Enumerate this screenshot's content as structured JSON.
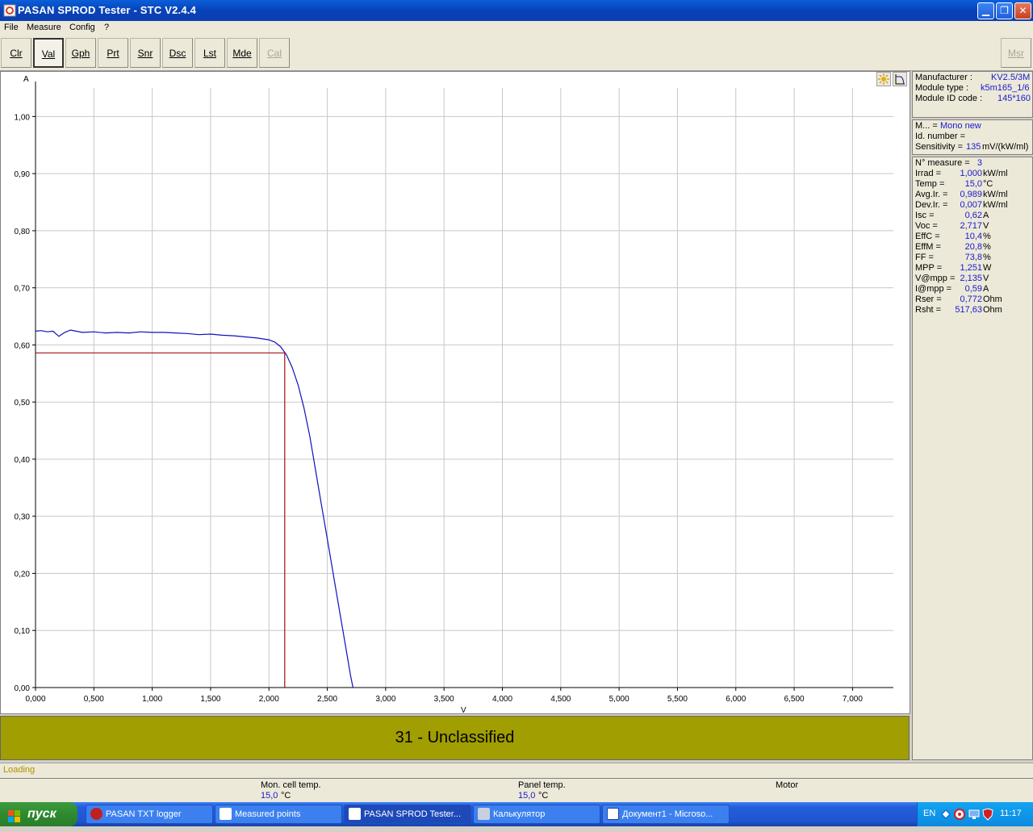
{
  "window": {
    "title": "PASAN SPROD Tester - STC V2.4.4"
  },
  "menu": [
    "File",
    "Measure",
    "Config",
    "?"
  ],
  "toolbar": {
    "buttons": [
      "Clr",
      "Val",
      "Gph",
      "Prt",
      "Snr",
      "Dsc",
      "Lst",
      "Mde",
      "Cal"
    ],
    "right_button": "Msr"
  },
  "module_info": {
    "manufacturer_label": "Manufacturer :",
    "manufacturer": "KV2.5/3M",
    "module_type_label": "Module type :",
    "module_type": "k5m165_1/6",
    "module_id_label": "Module ID code :",
    "module_id": "145*160"
  },
  "cell_info": {
    "m_label": "M... =",
    "m_value": "Mono new",
    "id_label": "Id. number =",
    "sensitivity_label": "Sensitivity =",
    "sensitivity": "135",
    "sensitivity_unit": "mV/(kW/ml)"
  },
  "results": [
    {
      "label": "N° measure =",
      "value": "3",
      "unit": ""
    },
    {
      "label": "Irrad =",
      "value": "1,000",
      "unit": "kW/ml"
    },
    {
      "label": "Temp =",
      "value": "15,0",
      "unit": "°C"
    },
    {
      "label": "Avg.Ir. =",
      "value": "0,989",
      "unit": "kW/ml"
    },
    {
      "label": "Dev.Ir. =",
      "value": "0,007",
      "unit": "kW/ml"
    },
    {
      "label": "Isc =",
      "value": "0,62",
      "unit": "A"
    },
    {
      "label": "Voc =",
      "value": "2,717",
      "unit": "V"
    },
    {
      "label": "EffC =",
      "value": "10,4",
      "unit": "%"
    },
    {
      "label": "EffM =",
      "value": "20,8",
      "unit": "%"
    },
    {
      "label": "FF =",
      "value": "73,8",
      "unit": "%"
    },
    {
      "label": "MPP =",
      "value": "1,251",
      "unit": "W"
    },
    {
      "label": "V@mpp =",
      "value": "2,135",
      "unit": "V"
    },
    {
      "label": "I@mpp =",
      "value": "0,59",
      "unit": "A"
    },
    {
      "label": "Rser =",
      "value": "0,772",
      "unit": "Ohm"
    },
    {
      "label": "Rsht =",
      "value": "517,63",
      "unit": "Ohm"
    }
  ],
  "classification": "31 - Unclassified",
  "status": {
    "loading": "Loading",
    "mon_cell_label": "Mon. cell temp.",
    "mon_cell_value": "15,0",
    "mon_cell_unit": "°C",
    "panel_label": "Panel temp.",
    "panel_value": "15,0",
    "panel_unit": "°C",
    "motor_label": "Motor"
  },
  "taskbar": {
    "start": "пуск",
    "tasks": [
      {
        "label": "PASAN TXT logger",
        "active": false
      },
      {
        "label": "Measured points",
        "active": false
      },
      {
        "label": "PASAN SPROD Tester...",
        "active": true
      },
      {
        "label": "Калькулятор",
        "active": false
      },
      {
        "label": "Документ1 - Microso...",
        "active": false
      }
    ],
    "lang": "EN",
    "clock": "11:17"
  },
  "chart_data": {
    "type": "line",
    "xlabel": "V",
    "ylabel": "A",
    "xlim": [
      0,
      7.35
    ],
    "ylim": [
      0,
      1.05
    ],
    "x_ticks": [
      "0,000",
      "0,500",
      "1,000",
      "1,500",
      "2,000",
      "2,500",
      "3,000",
      "3,500",
      "4,000",
      "4,500",
      "5,000",
      "5,500",
      "6,000",
      "6,500",
      "7,000"
    ],
    "y_ticks": [
      "0,00",
      "0,10",
      "0,20",
      "0,30",
      "0,40",
      "0,50",
      "0,60",
      "0,70",
      "0,80",
      "0,90",
      "1,00"
    ],
    "grid": true,
    "colors": {
      "curve": "#1010c0",
      "mpp": "#a01010",
      "grid": "#c8c8c8"
    },
    "series": [
      {
        "x": [
          0.0,
          0.05,
          0.1,
          0.15,
          0.2,
          0.25,
          0.3,
          0.4,
          0.5,
          0.6,
          0.7,
          0.8,
          0.9,
          1.0,
          1.1,
          1.2,
          1.3,
          1.4,
          1.5,
          1.6,
          1.7,
          1.8,
          1.9,
          2.0,
          2.05,
          2.1,
          2.15,
          2.2,
          2.25,
          2.3,
          2.35,
          2.4,
          2.45,
          2.5,
          2.55,
          2.6,
          2.65,
          2.7,
          2.72
        ],
        "y": [
          0.624,
          0.625,
          0.623,
          0.624,
          0.615,
          0.622,
          0.626,
          0.622,
          0.623,
          0.621,
          0.622,
          0.621,
          0.623,
          0.622,
          0.622,
          0.621,
          0.62,
          0.618,
          0.619,
          0.617,
          0.616,
          0.614,
          0.612,
          0.609,
          0.605,
          0.597,
          0.583,
          0.56,
          0.53,
          0.49,
          0.44,
          0.38,
          0.32,
          0.26,
          0.2,
          0.14,
          0.08,
          0.02,
          0.0
        ]
      },
      {
        "x": [
          0.0,
          2.135,
          2.135
        ],
        "y": [
          0.586,
          0.586,
          0.0
        ]
      }
    ]
  }
}
